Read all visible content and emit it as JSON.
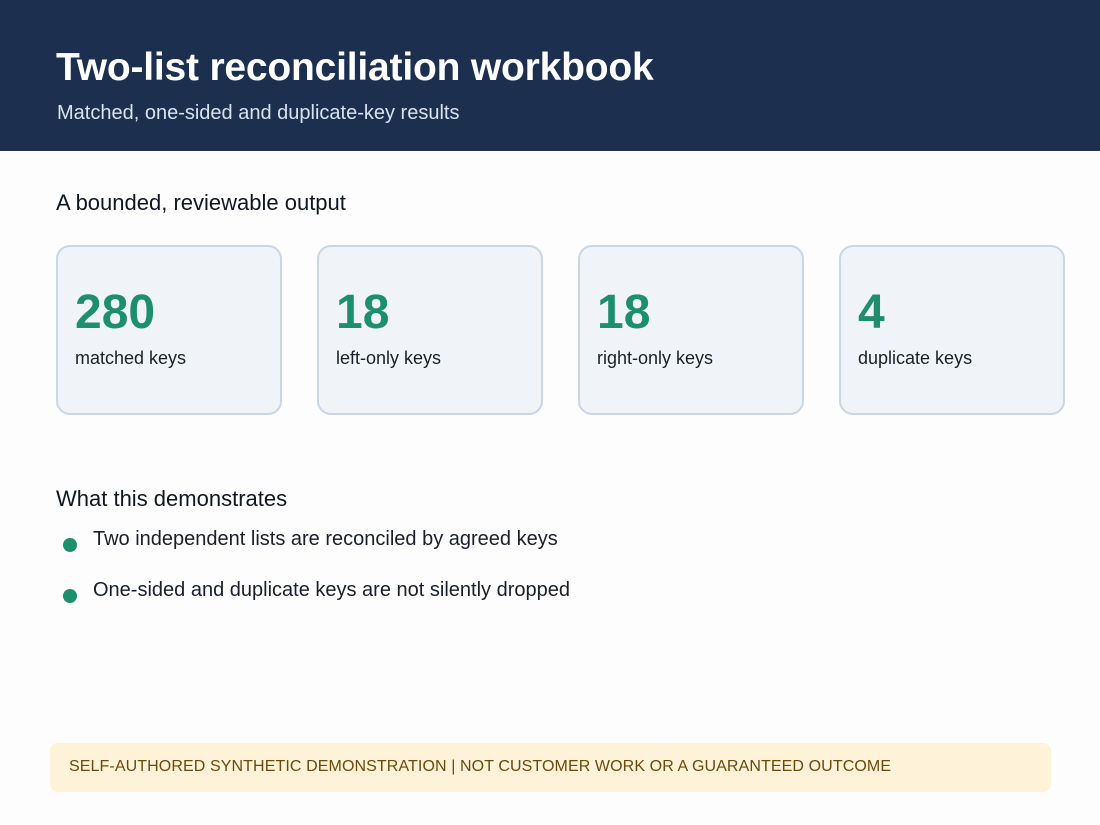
{
  "header": {
    "title": "Two-list reconciliation workbook",
    "subtitle": "Matched, one-sided and duplicate-key results"
  },
  "output_section": {
    "heading": "A bounded, reviewable output",
    "cards": [
      {
        "value": "280",
        "label": "matched keys"
      },
      {
        "value": "18",
        "label": "left-only keys"
      },
      {
        "value": "18",
        "label": "right-only keys"
      },
      {
        "value": "4",
        "label": "duplicate keys"
      }
    ]
  },
  "demo_section": {
    "heading": "What this demonstrates",
    "bullets": [
      "Two independent lists are reconciled by agreed keys",
      "One-sided and duplicate keys are not silently dropped"
    ]
  },
  "footer": {
    "disclaimer": "SELF-AUTHORED SYNTHETIC DEMONSTRATION  |  NOT CUSTOMER WORK OR A GUARANTEED OUTCOME"
  },
  "colors": {
    "header_background": "#1c2f4f",
    "accent_green": "#1e8f6e",
    "card_background": "#f0f4f9",
    "card_border": "#c9d6e6",
    "disclaimer_background": "#fef3d8",
    "disclaimer_text": "#6b4a0c"
  }
}
